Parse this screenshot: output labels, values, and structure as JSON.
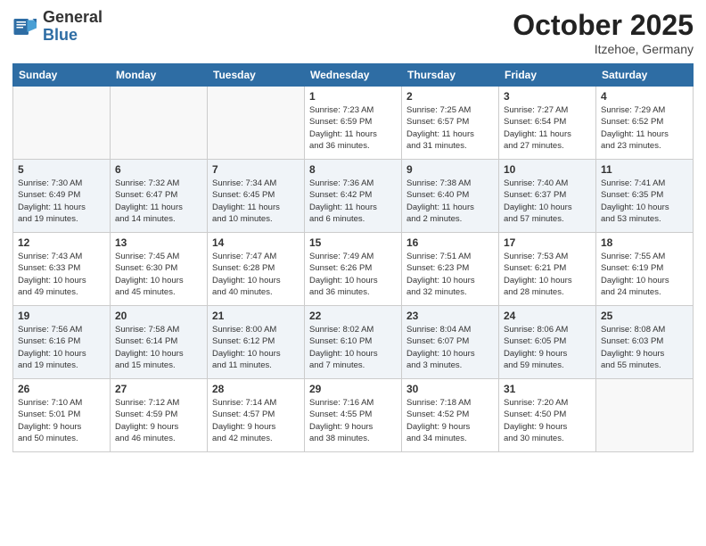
{
  "logo": {
    "general": "General",
    "blue": "Blue"
  },
  "header": {
    "month": "October 2025",
    "location": "Itzehoe, Germany"
  },
  "weekdays": [
    "Sunday",
    "Monday",
    "Tuesday",
    "Wednesday",
    "Thursday",
    "Friday",
    "Saturday"
  ],
  "weeks": [
    [
      {
        "day": "",
        "info": ""
      },
      {
        "day": "",
        "info": ""
      },
      {
        "day": "",
        "info": ""
      },
      {
        "day": "1",
        "info": "Sunrise: 7:23 AM\nSunset: 6:59 PM\nDaylight: 11 hours\nand 36 minutes."
      },
      {
        "day": "2",
        "info": "Sunrise: 7:25 AM\nSunset: 6:57 PM\nDaylight: 11 hours\nand 31 minutes."
      },
      {
        "day": "3",
        "info": "Sunrise: 7:27 AM\nSunset: 6:54 PM\nDaylight: 11 hours\nand 27 minutes."
      },
      {
        "day": "4",
        "info": "Sunrise: 7:29 AM\nSunset: 6:52 PM\nDaylight: 11 hours\nand 23 minutes."
      }
    ],
    [
      {
        "day": "5",
        "info": "Sunrise: 7:30 AM\nSunset: 6:49 PM\nDaylight: 11 hours\nand 19 minutes."
      },
      {
        "day": "6",
        "info": "Sunrise: 7:32 AM\nSunset: 6:47 PM\nDaylight: 11 hours\nand 14 minutes."
      },
      {
        "day": "7",
        "info": "Sunrise: 7:34 AM\nSunset: 6:45 PM\nDaylight: 11 hours\nand 10 minutes."
      },
      {
        "day": "8",
        "info": "Sunrise: 7:36 AM\nSunset: 6:42 PM\nDaylight: 11 hours\nand 6 minutes."
      },
      {
        "day": "9",
        "info": "Sunrise: 7:38 AM\nSunset: 6:40 PM\nDaylight: 11 hours\nand 2 minutes."
      },
      {
        "day": "10",
        "info": "Sunrise: 7:40 AM\nSunset: 6:37 PM\nDaylight: 10 hours\nand 57 minutes."
      },
      {
        "day": "11",
        "info": "Sunrise: 7:41 AM\nSunset: 6:35 PM\nDaylight: 10 hours\nand 53 minutes."
      }
    ],
    [
      {
        "day": "12",
        "info": "Sunrise: 7:43 AM\nSunset: 6:33 PM\nDaylight: 10 hours\nand 49 minutes."
      },
      {
        "day": "13",
        "info": "Sunrise: 7:45 AM\nSunset: 6:30 PM\nDaylight: 10 hours\nand 45 minutes."
      },
      {
        "day": "14",
        "info": "Sunrise: 7:47 AM\nSunset: 6:28 PM\nDaylight: 10 hours\nand 40 minutes."
      },
      {
        "day": "15",
        "info": "Sunrise: 7:49 AM\nSunset: 6:26 PM\nDaylight: 10 hours\nand 36 minutes."
      },
      {
        "day": "16",
        "info": "Sunrise: 7:51 AM\nSunset: 6:23 PM\nDaylight: 10 hours\nand 32 minutes."
      },
      {
        "day": "17",
        "info": "Sunrise: 7:53 AM\nSunset: 6:21 PM\nDaylight: 10 hours\nand 28 minutes."
      },
      {
        "day": "18",
        "info": "Sunrise: 7:55 AM\nSunset: 6:19 PM\nDaylight: 10 hours\nand 24 minutes."
      }
    ],
    [
      {
        "day": "19",
        "info": "Sunrise: 7:56 AM\nSunset: 6:16 PM\nDaylight: 10 hours\nand 19 minutes."
      },
      {
        "day": "20",
        "info": "Sunrise: 7:58 AM\nSunset: 6:14 PM\nDaylight: 10 hours\nand 15 minutes."
      },
      {
        "day": "21",
        "info": "Sunrise: 8:00 AM\nSunset: 6:12 PM\nDaylight: 10 hours\nand 11 minutes."
      },
      {
        "day": "22",
        "info": "Sunrise: 8:02 AM\nSunset: 6:10 PM\nDaylight: 10 hours\nand 7 minutes."
      },
      {
        "day": "23",
        "info": "Sunrise: 8:04 AM\nSunset: 6:07 PM\nDaylight: 10 hours\nand 3 minutes."
      },
      {
        "day": "24",
        "info": "Sunrise: 8:06 AM\nSunset: 6:05 PM\nDaylight: 9 hours\nand 59 minutes."
      },
      {
        "day": "25",
        "info": "Sunrise: 8:08 AM\nSunset: 6:03 PM\nDaylight: 9 hours\nand 55 minutes."
      }
    ],
    [
      {
        "day": "26",
        "info": "Sunrise: 7:10 AM\nSunset: 5:01 PM\nDaylight: 9 hours\nand 50 minutes."
      },
      {
        "day": "27",
        "info": "Sunrise: 7:12 AM\nSunset: 4:59 PM\nDaylight: 9 hours\nand 46 minutes."
      },
      {
        "day": "28",
        "info": "Sunrise: 7:14 AM\nSunset: 4:57 PM\nDaylight: 9 hours\nand 42 minutes."
      },
      {
        "day": "29",
        "info": "Sunrise: 7:16 AM\nSunset: 4:55 PM\nDaylight: 9 hours\nand 38 minutes."
      },
      {
        "day": "30",
        "info": "Sunrise: 7:18 AM\nSunset: 4:52 PM\nDaylight: 9 hours\nand 34 minutes."
      },
      {
        "day": "31",
        "info": "Sunrise: 7:20 AM\nSunset: 4:50 PM\nDaylight: 9 hours\nand 30 minutes."
      },
      {
        "day": "",
        "info": ""
      }
    ]
  ]
}
